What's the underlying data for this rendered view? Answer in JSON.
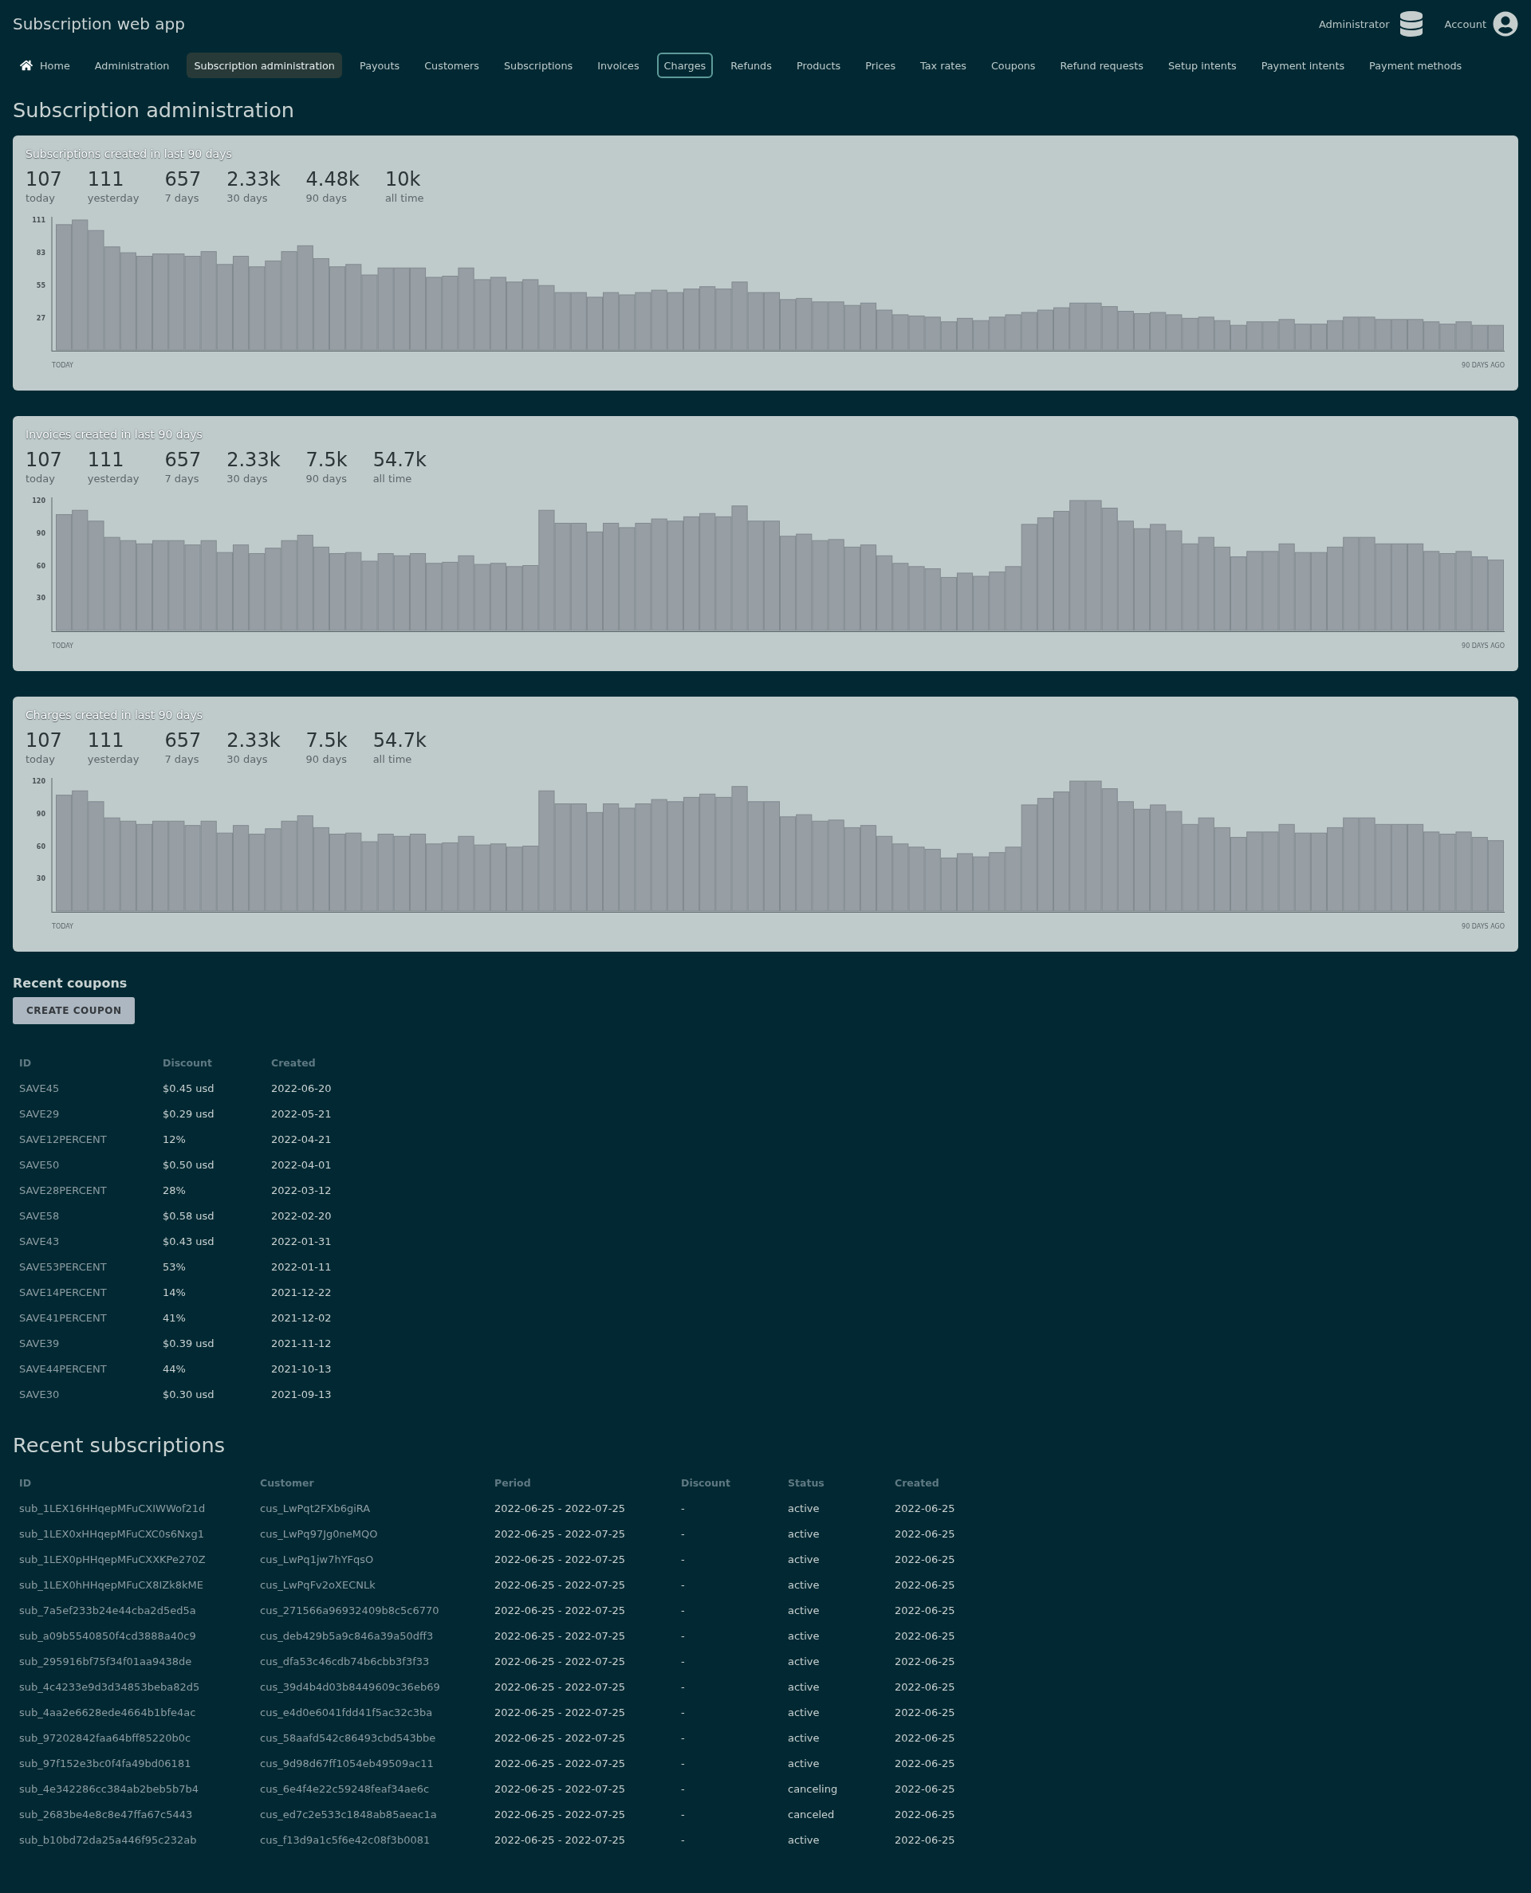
{
  "app_bar": {
    "title": "Subscription web app",
    "admin_label": "Administrator",
    "account_label": "Account"
  },
  "nav": [
    {
      "label": "Home",
      "selected": false,
      "focused": false
    },
    {
      "label": "Administration",
      "selected": false,
      "focused": false
    },
    {
      "label": "Subscription administration",
      "selected": true,
      "focused": false
    },
    {
      "label": "Payouts",
      "selected": false,
      "focused": false
    },
    {
      "label": "Customers",
      "selected": false,
      "focused": false
    },
    {
      "label": "Subscriptions",
      "selected": false,
      "focused": false
    },
    {
      "label": "Invoices",
      "selected": false,
      "focused": false
    },
    {
      "label": "Charges",
      "selected": false,
      "focused": true
    },
    {
      "label": "Refunds",
      "selected": false,
      "focused": false
    },
    {
      "label": "Products",
      "selected": false,
      "focused": false
    },
    {
      "label": "Prices",
      "selected": false,
      "focused": false
    },
    {
      "label": "Tax rates",
      "selected": false,
      "focused": false
    },
    {
      "label": "Coupons",
      "selected": false,
      "focused": false
    },
    {
      "label": "Refund requests",
      "selected": false,
      "focused": false
    },
    {
      "label": "Setup intents",
      "selected": false,
      "focused": false
    },
    {
      "label": "Payment intents",
      "selected": false,
      "focused": false
    },
    {
      "label": "Payment methods",
      "selected": false,
      "focused": false
    }
  ],
  "page_title": "Subscription administration",
  "stat_cards": [
    {
      "title": "Subscriptions created in last 90 days",
      "stats": [
        {
          "value": "107",
          "label": "today"
        },
        {
          "value": "111",
          "label": "yesterday"
        },
        {
          "value": "657",
          "label": "7 days"
        },
        {
          "value": "2.33k",
          "label": "30 days"
        },
        {
          "value": "4.48k",
          "label": "90 days"
        },
        {
          "value": "10k",
          "label": "all time"
        }
      ],
      "axis_start_label": "TODAY",
      "axis_end_label": "90 DAYS AGO",
      "chart_data": {
        "type": "bar",
        "ylim": [
          0,
          111
        ],
        "yticks": [
          27,
          55,
          83,
          111
        ],
        "values": [
          107,
          111,
          102,
          88,
          83,
          80,
          82,
          82,
          80,
          84,
          73,
          80,
          71,
          76,
          84,
          89,
          78,
          71,
          73,
          64,
          70,
          70,
          70,
          62,
          63,
          70,
          60,
          62,
          58,
          60,
          55,
          49,
          49,
          45,
          49,
          47,
          49,
          51,
          49,
          52,
          54,
          52,
          58,
          49,
          49,
          43,
          44,
          41,
          41,
          38,
          40,
          34,
          30,
          29,
          28,
          24,
          27,
          25,
          28,
          30,
          32,
          34,
          36,
          40,
          40,
          37,
          33,
          31,
          32,
          30,
          27,
          28,
          25,
          21,
          24,
          24,
          26,
          22,
          22,
          25,
          28,
          28,
          26,
          26,
          26,
          24,
          22,
          24,
          21,
          21
        ]
      }
    },
    {
      "title": "Invoices created in last 90 days",
      "stats": [
        {
          "value": "107",
          "label": "today"
        },
        {
          "value": "111",
          "label": "yesterday"
        },
        {
          "value": "657",
          "label": "7 days"
        },
        {
          "value": "2.33k",
          "label": "30 days"
        },
        {
          "value": "7.5k",
          "label": "90 days"
        },
        {
          "value": "54.7k",
          "label": "all time"
        }
      ],
      "axis_start_label": "TODAY",
      "axis_end_label": "90 DAYS AGO",
      "chart_data": {
        "type": "bar",
        "ylim": [
          0,
          120
        ],
        "yticks": [
          30,
          60,
          90,
          120
        ],
        "values": [
          107,
          111,
          101,
          86,
          83,
          80,
          83,
          83,
          79,
          83,
          72,
          79,
          71,
          76,
          83,
          88,
          77,
          71,
          72,
          64,
          71,
          69,
          71,
          62,
          63,
          69,
          61,
          62,
          59,
          60,
          111,
          99,
          99,
          91,
          99,
          95,
          99,
          103,
          101,
          105,
          108,
          105,
          115,
          101,
          101,
          87,
          89,
          83,
          84,
          77,
          79,
          69,
          62,
          59,
          57,
          49,
          53,
          50,
          54,
          59,
          98,
          104,
          110,
          120,
          120,
          113,
          101,
          94,
          98,
          92,
          80,
          86,
          77,
          68,
          73,
          73,
          80,
          72,
          72,
          77,
          86,
          86,
          80,
          80,
          80,
          73,
          71,
          73,
          68,
          65
        ]
      }
    },
    {
      "title": "Charges created in last 90 days",
      "stats": [
        {
          "value": "107",
          "label": "today"
        },
        {
          "value": "111",
          "label": "yesterday"
        },
        {
          "value": "657",
          "label": "7 days"
        },
        {
          "value": "2.33k",
          "label": "30 days"
        },
        {
          "value": "7.5k",
          "label": "90 days"
        },
        {
          "value": "54.7k",
          "label": "all time"
        }
      ],
      "axis_start_label": "TODAY",
      "axis_end_label": "90 DAYS AGO",
      "chart_data": {
        "type": "bar",
        "ylim": [
          0,
          120
        ],
        "yticks": [
          30,
          60,
          90,
          120
        ],
        "values": [
          107,
          111,
          101,
          86,
          83,
          80,
          83,
          83,
          79,
          83,
          72,
          79,
          71,
          76,
          83,
          88,
          77,
          71,
          72,
          64,
          71,
          69,
          71,
          62,
          63,
          69,
          61,
          62,
          59,
          60,
          111,
          99,
          99,
          91,
          99,
          95,
          99,
          103,
          101,
          105,
          108,
          105,
          115,
          101,
          101,
          87,
          89,
          83,
          84,
          77,
          79,
          69,
          62,
          59,
          57,
          49,
          53,
          50,
          54,
          59,
          98,
          104,
          110,
          120,
          120,
          113,
          101,
          94,
          98,
          92,
          80,
          86,
          77,
          68,
          73,
          73,
          80,
          72,
          72,
          77,
          86,
          86,
          80,
          80,
          80,
          73,
          71,
          73,
          68,
          65
        ]
      }
    }
  ],
  "coupons": {
    "title": "Recent coupons",
    "create_button": "CREATE COUPON",
    "columns": [
      "ID",
      "Discount",
      "Created"
    ],
    "rows": [
      [
        "SAVE45",
        "$0.45 usd",
        "2022-06-20"
      ],
      [
        "SAVE29",
        "$0.29 usd",
        "2022-05-21"
      ],
      [
        "SAVE12PERCENT",
        "12%",
        "2022-04-21"
      ],
      [
        "SAVE50",
        "$0.50 usd",
        "2022-04-01"
      ],
      [
        "SAVE28PERCENT",
        "28%",
        "2022-03-12"
      ],
      [
        "SAVE58",
        "$0.58 usd",
        "2022-02-20"
      ],
      [
        "SAVE43",
        "$0.43 usd",
        "2022-01-31"
      ],
      [
        "SAVE53PERCENT",
        "53%",
        "2022-01-11"
      ],
      [
        "SAVE14PERCENT",
        "14%",
        "2021-12-22"
      ],
      [
        "SAVE41PERCENT",
        "41%",
        "2021-12-02"
      ],
      [
        "SAVE39",
        "$0.39 usd",
        "2021-11-12"
      ],
      [
        "SAVE44PERCENT",
        "44%",
        "2021-10-13"
      ],
      [
        "SAVE30",
        "$0.30 usd",
        "2021-09-13"
      ]
    ]
  },
  "subscriptions": {
    "title": "Recent subscriptions",
    "columns": [
      "ID",
      "Customer",
      "Period",
      "Discount",
      "Status",
      "Created"
    ],
    "rows": [
      [
        "sub_1LEX16HHqepMFuCXIWWof21d",
        "cus_LwPqt2FXb6giRA",
        "2022-06-25 - 2022-07-25",
        "-",
        "active",
        "2022-06-25"
      ],
      [
        "sub_1LEX0xHHqepMFuCXC0s6Nxg1",
        "cus_LwPq97Jg0neMQO",
        "2022-06-25 - 2022-07-25",
        "-",
        "active",
        "2022-06-25"
      ],
      [
        "sub_1LEX0pHHqepMFuCXXKPe270Z",
        "cus_LwPq1jw7hYFqsO",
        "2022-06-25 - 2022-07-25",
        "-",
        "active",
        "2022-06-25"
      ],
      [
        "sub_1LEX0hHHqepMFuCX8IZk8kME",
        "cus_LwPqFv2oXECNLk",
        "2022-06-25 - 2022-07-25",
        "-",
        "active",
        "2022-06-25"
      ],
      [
        "sub_7a5ef233b24e44cba2d5ed5a",
        "cus_271566a96932409b8c5c6770",
        "2022-06-25 - 2022-07-25",
        "-",
        "active",
        "2022-06-25"
      ],
      [
        "sub_a09b5540850f4cd3888a40c9",
        "cus_deb429b5a9c846a39a50dff3",
        "2022-06-25 - 2022-07-25",
        "-",
        "active",
        "2022-06-25"
      ],
      [
        "sub_295916bf75f34f01aa9438de",
        "cus_dfa53c46cdb74b6cbb3f3f33",
        "2022-06-25 - 2022-07-25",
        "-",
        "active",
        "2022-06-25"
      ],
      [
        "sub_4c4233e9d3d34853beba82d5",
        "cus_39d4b4d03b8449609c36eb69",
        "2022-06-25 - 2022-07-25",
        "-",
        "active",
        "2022-06-25"
      ],
      [
        "sub_4aa2e6628ede4664b1bfe4ac",
        "cus_e4d0e6041fdd41f5ac32c3ba",
        "2022-06-25 - 2022-07-25",
        "-",
        "active",
        "2022-06-25"
      ],
      [
        "sub_97202842faa64bff85220b0c",
        "cus_58aafd542c86493cbd543bbe",
        "2022-06-25 - 2022-07-25",
        "-",
        "active",
        "2022-06-25"
      ],
      [
        "sub_97f152e3bc0f4fa49bd06181",
        "cus_9d98d67ff1054eb49509ac11",
        "2022-06-25 - 2022-07-25",
        "-",
        "active",
        "2022-06-25"
      ],
      [
        "sub_4e342286cc384ab2beb5b7b4",
        "cus_6e4f4e22c59248feaf34ae6c",
        "2022-06-25 - 2022-07-25",
        "-",
        "canceling",
        "2022-06-25"
      ],
      [
        "sub_2683be4e8c8e47ffa67c5443",
        "cus_ed7c2e533c1848ab85aeac1a",
        "2022-06-25 - 2022-07-25",
        "-",
        "canceled",
        "2022-06-25"
      ],
      [
        "sub_b10bd72da25a446f95c232ab",
        "cus_f13d9a1c5f6e42c08f3b0081",
        "2022-06-25 - 2022-07-25",
        "-",
        "active",
        "2022-06-25"
      ]
    ]
  }
}
